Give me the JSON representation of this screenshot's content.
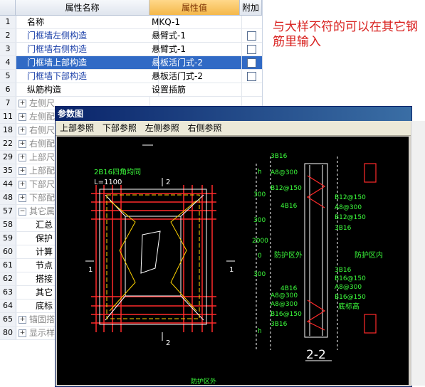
{
  "grid": {
    "headers": {
      "name": "属性名称",
      "value": "属性值",
      "extra": "附加"
    },
    "rows": [
      {
        "num": "1",
        "name": "名称",
        "value": "MKQ-1"
      },
      {
        "num": "2",
        "name": "门框墙左侧构造",
        "value": "悬臂式-1"
      },
      {
        "num": "3",
        "name": "门框墙右侧构造",
        "value": "悬臂式-1"
      },
      {
        "num": "4",
        "name": "门框墙上部构造",
        "value": "悬板活门式-2"
      },
      {
        "num": "5",
        "name": "门框墙下部构造",
        "value": "悬板活门式-2"
      },
      {
        "num": "6",
        "name": "纵筋构造",
        "value": "设置插筋"
      },
      {
        "num": "7",
        "name": "左侧尺"
      },
      {
        "num": "11",
        "name": "左侧配"
      },
      {
        "num": "18",
        "name": "右侧尺"
      },
      {
        "num": "22",
        "name": "右侧配"
      },
      {
        "num": "29",
        "name": "上部尺"
      },
      {
        "num": "35",
        "name": "上部配"
      },
      {
        "num": "44",
        "name": "下部尺"
      },
      {
        "num": "48",
        "name": "下部配"
      },
      {
        "num": "57",
        "name": "其它属"
      },
      {
        "num": "58",
        "name": "汇总"
      },
      {
        "num": "59",
        "name": "保护"
      },
      {
        "num": "60",
        "name": "计算"
      },
      {
        "num": "61",
        "name": "节点"
      },
      {
        "num": "62",
        "name": "搭接"
      },
      {
        "num": "63",
        "name": "其它"
      },
      {
        "num": "64",
        "name": "底标"
      },
      {
        "num": "65",
        "name": "锚固搭"
      },
      {
        "num": "80",
        "name": "显示样"
      }
    ]
  },
  "annotation": "与大样不符的可以在其它钢筋里输入",
  "dialog": {
    "title": "参数图",
    "menu": [
      "上部参照",
      "下部参照",
      "左侧参照",
      "右侧参照"
    ],
    "drawing": {
      "left_labels": {
        "top_rebar": "2B16四角均同",
        "length": "L=1100",
        "section": "2",
        "side": "1"
      },
      "section_title": "2-2",
      "dims": [
        "h",
        "300",
        "300",
        "2000",
        "0",
        "300",
        "h"
      ],
      "rebars": [
        "3B16",
        "A8@300",
        "B12@150",
        "B12@150",
        "4B16",
        "A8@300",
        "B12@150",
        "3B16",
        "3B16",
        "B16@150",
        "A8@300",
        "B16@150",
        "A8@300",
        "4B16",
        "3B16",
        "B16@150",
        "A8@300"
      ],
      "zones": {
        "outside": "防护区外",
        "inside": "防护区内",
        "bottom": "底标高"
      },
      "partial": "防护区外"
    }
  },
  "colors": {
    "selected": "#316ac5",
    "header_value": "#f4b84a",
    "annotation": "#d8201e"
  }
}
